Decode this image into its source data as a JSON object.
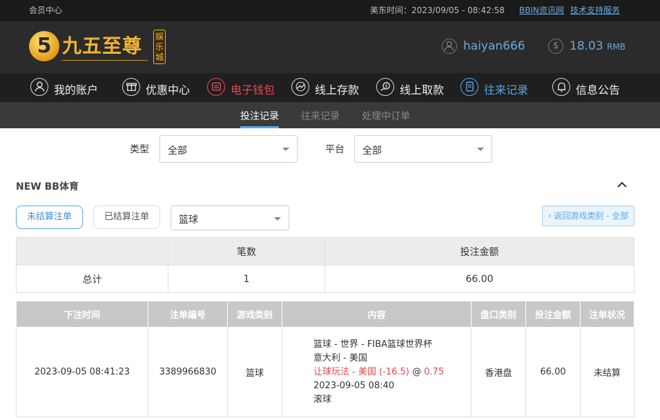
{
  "topbar": {
    "member_center": "会员中心",
    "time_label": "美东时间：2023/09/05 - 08:42:58",
    "bbin_link": "BBIN资讯网",
    "support_link": "技术支持服务"
  },
  "header": {
    "logo_mark": "5",
    "logo_text": "九五至尊",
    "logo_badge": "娱乐城",
    "username": "haiyan666",
    "balance": "18.03",
    "currency": "RMB"
  },
  "nav": [
    {
      "label": "我的账户",
      "icon": "user-icon"
    },
    {
      "label": "优惠中心",
      "icon": "gift-icon"
    },
    {
      "label": "电子钱包",
      "icon": "wallet-icon"
    },
    {
      "label": "线上存款",
      "icon": "deposit-icon"
    },
    {
      "label": "线上取款",
      "icon": "withdraw-icon"
    },
    {
      "label": "往来记录",
      "icon": "records-icon"
    },
    {
      "label": "信息公告",
      "icon": "bell-icon"
    }
  ],
  "subtabs": [
    "投注记录",
    "往来记录",
    "处理中订单"
  ],
  "filters": {
    "type_label": "类型",
    "type_value": "全部",
    "platform_label": "平台",
    "platform_value": "全部"
  },
  "section": {
    "title": "NEW BB体育",
    "unsettled_btn": "未结算注单",
    "settled_btn": "已结算注单",
    "sport_value": "篮球",
    "back_btn": "‹ 返回游戏类别 - 全部"
  },
  "summary": {
    "headers": [
      "",
      "笔数",
      "投注金额"
    ],
    "row": [
      "总计",
      "1",
      "66.00"
    ]
  },
  "detail": {
    "headers": [
      "下注时间",
      "注单编号",
      "游戏类别",
      "内容",
      "盘口类别",
      "投注金额",
      "注单状况"
    ],
    "row": {
      "time": "2023-09-05 08:41:23",
      "id": "3389966830",
      "game": "篮球",
      "content_line1": "篮球 - 世界 - FIBA篮球世界杯",
      "content_line2": "意大利 - 美国",
      "content_bet": "让球玩法 - 美国 (-16.5)",
      "content_at": " @ ",
      "content_odds": "0.75",
      "content_date": "2023-09-05 08:40",
      "content_mode": "滚球",
      "market": "香港盘",
      "amount": "66.00",
      "status": "未结算"
    }
  },
  "colors": {
    "accent_blue": "#5aa6e8",
    "accent_red": "#e24a55",
    "logo_gold": "#f2b632"
  }
}
